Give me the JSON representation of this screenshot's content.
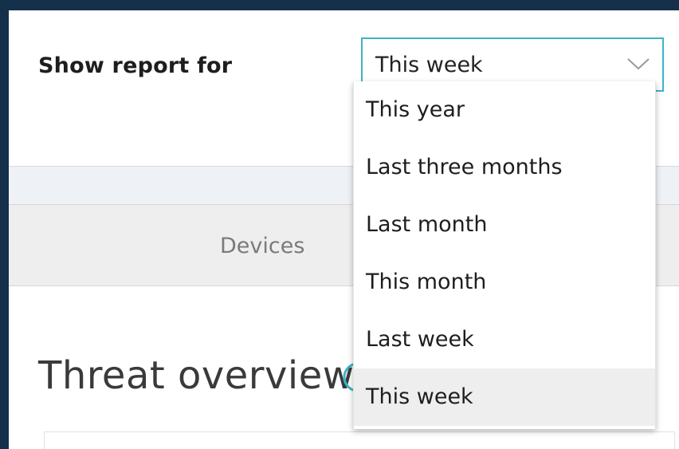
{
  "filter": {
    "label": "Show report for",
    "selected": "This week",
    "options": [
      "This year",
      "Last three months",
      "Last month",
      "This month",
      "Last week",
      "This week"
    ]
  },
  "tabs": {
    "devices_label": "Devices"
  },
  "main": {
    "section_title": "Threat overview"
  },
  "colors": {
    "frame": "#14304a",
    "accent": "#3ab4c8",
    "selected_option_bg": "#eeeeee"
  }
}
